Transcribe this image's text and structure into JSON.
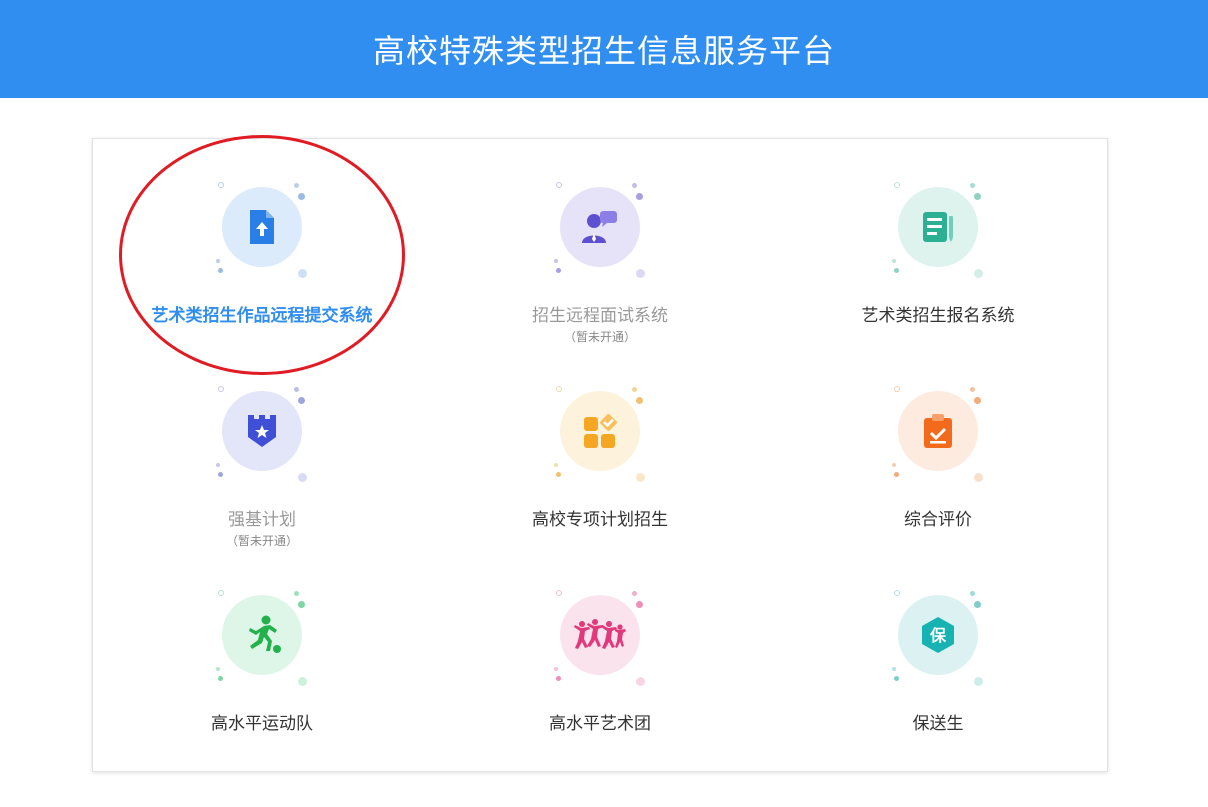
{
  "header": {
    "title": "高校特殊类型招生信息服务平台"
  },
  "colors": {
    "header_bg": "#2f8ef0",
    "highlight_text": "#2f8ef0",
    "annotation_ring": "#e01b24"
  },
  "services": [
    {
      "label": "艺术类招生作品远程提交系统",
      "sub": "",
      "icon": "file-upload-icon",
      "state": "highlighted"
    },
    {
      "label": "招生远程面试系统",
      "sub": "（暂未开通）",
      "icon": "interview-icon",
      "state": "disabled"
    },
    {
      "label": "艺术类招生报名系统",
      "sub": "",
      "icon": "registration-form-icon",
      "state": "normal"
    },
    {
      "label": "强基计划",
      "sub": "（暂未开通）",
      "icon": "castle-shield-icon",
      "state": "disabled"
    },
    {
      "label": "高校专项计划招生",
      "sub": "",
      "icon": "grid-check-icon",
      "state": "normal"
    },
    {
      "label": "综合评价",
      "sub": "",
      "icon": "clipboard-check-icon",
      "state": "normal"
    },
    {
      "label": "高水平运动队",
      "sub": "",
      "icon": "soccer-player-icon",
      "state": "normal"
    },
    {
      "label": "高水平艺术团",
      "sub": "",
      "icon": "dancers-icon",
      "state": "normal"
    },
    {
      "label": "保送生",
      "sub": "",
      "icon": "bao-hexagon-icon",
      "state": "normal"
    }
  ],
  "service_badge": {
    "bao": "保"
  }
}
